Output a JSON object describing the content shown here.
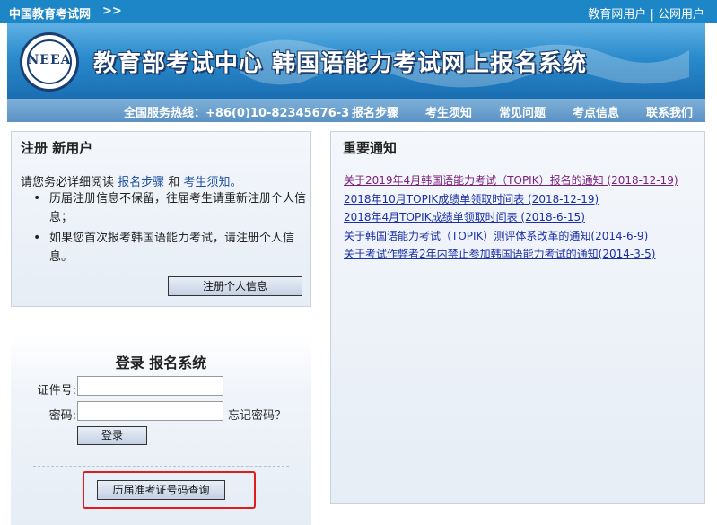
{
  "topbar": {
    "brand": "中国教育考试网",
    "arrows": ">>",
    "links": [
      "教育网用户",
      "公网用户"
    ],
    "separator": "|"
  },
  "banner": {
    "logo_text": "NEEA",
    "title": "教育部考试中心  韩国语能力考试网上报名系统"
  },
  "navbar": {
    "hotline": "全国服务热线：+86(0)10-82345676-3",
    "items": [
      "报名步骤",
      "考生须知",
      "常见问题",
      "考点信息",
      "联系我们"
    ]
  },
  "register": {
    "title": "注册 新用户",
    "intro_prefix": "请您务必详细阅读",
    "link1": "报名步骤",
    "and": "和",
    "link2": "考生须知。",
    "bullets": [
      "历届注册信息不保留，往届考生请重新注册个人信息；",
      "如果您首次报考韩国语能力考试，请注册个人信息。"
    ],
    "button": "注册个人信息"
  },
  "login": {
    "title": "登录 报名系统",
    "id_label": "证件号:",
    "id_value": "",
    "password_label": "密码:",
    "password_value": "",
    "forgot": "忘记密码？",
    "login_button": "登录",
    "history_button": "历届准考证号码查询"
  },
  "notice": {
    "title": "重要通知",
    "items": [
      "关于2019年4月韩国语能力考试（TOPIK）报名的通知 (2018-12-19)",
      "2018年10月TOPIK成绩单领取时间表 (2018-12-19)",
      "2018年4月TOPIK成绩单领取时间表 (2018-6-15)",
      "关于韩国语能力考试（TOPIK）测评体系改革的通知(2014-6-9)",
      "关于考试作弊者2年内禁止参加韩国语能力考试的通知(2014-3-5)"
    ]
  },
  "colors": {
    "topbar": "#1c86c6",
    "highlight_box": "#e21b1b",
    "link": "#1a2fa8"
  }
}
